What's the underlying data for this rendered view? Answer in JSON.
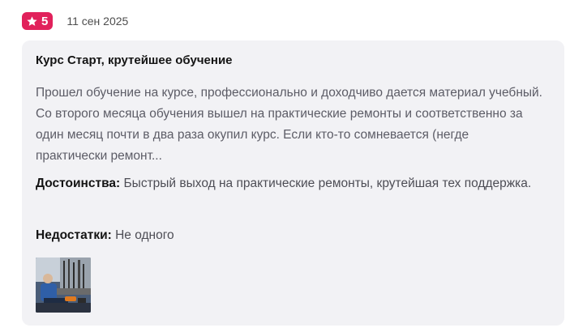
{
  "review": {
    "rating": "5",
    "date": "11 сен 2025",
    "title": "Курс Старт, крутейшее обучение",
    "text": "Прошел обучение на курсе, профессионально и доходчиво дается материал учебный. Со второго месяца обучения вышел на практические ремонты и соответственно за один месяц почти в два раза окупил курс. Если кто-то сомневается (негде практически ремонт...",
    "pros_label": "Достоинства:",
    "pros_text": "Быстрый выход на практические ремонты, крутейшая тех поддержка.",
    "cons_label": "Недостатки:",
    "cons_text": "Не одного"
  },
  "colors": {
    "badge": "#e1215b",
    "card_background": "#f2f2f5"
  },
  "icons": {
    "rating": "star-icon"
  }
}
